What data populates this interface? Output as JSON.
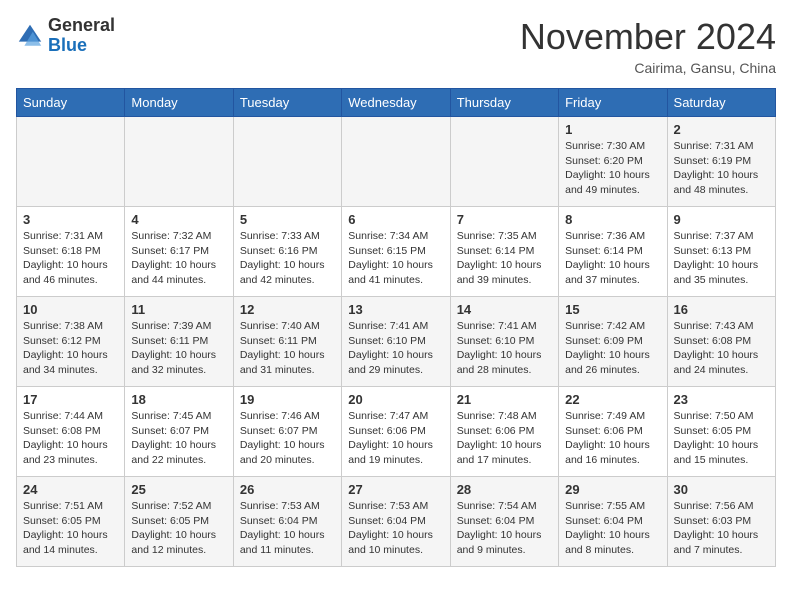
{
  "header": {
    "logo_line1": "General",
    "logo_line2": "Blue",
    "month": "November 2024",
    "location": "Cairima, Gansu, China"
  },
  "weekdays": [
    "Sunday",
    "Monday",
    "Tuesday",
    "Wednesday",
    "Thursday",
    "Friday",
    "Saturday"
  ],
  "weeks": [
    [
      {
        "day": "",
        "info": ""
      },
      {
        "day": "",
        "info": ""
      },
      {
        "day": "",
        "info": ""
      },
      {
        "day": "",
        "info": ""
      },
      {
        "day": "",
        "info": ""
      },
      {
        "day": "1",
        "info": "Sunrise: 7:30 AM\nSunset: 6:20 PM\nDaylight: 10 hours\nand 49 minutes."
      },
      {
        "day": "2",
        "info": "Sunrise: 7:31 AM\nSunset: 6:19 PM\nDaylight: 10 hours\nand 48 minutes."
      }
    ],
    [
      {
        "day": "3",
        "info": "Sunrise: 7:31 AM\nSunset: 6:18 PM\nDaylight: 10 hours\nand 46 minutes."
      },
      {
        "day": "4",
        "info": "Sunrise: 7:32 AM\nSunset: 6:17 PM\nDaylight: 10 hours\nand 44 minutes."
      },
      {
        "day": "5",
        "info": "Sunrise: 7:33 AM\nSunset: 6:16 PM\nDaylight: 10 hours\nand 42 minutes."
      },
      {
        "day": "6",
        "info": "Sunrise: 7:34 AM\nSunset: 6:15 PM\nDaylight: 10 hours\nand 41 minutes."
      },
      {
        "day": "7",
        "info": "Sunrise: 7:35 AM\nSunset: 6:14 PM\nDaylight: 10 hours\nand 39 minutes."
      },
      {
        "day": "8",
        "info": "Sunrise: 7:36 AM\nSunset: 6:14 PM\nDaylight: 10 hours\nand 37 minutes."
      },
      {
        "day": "9",
        "info": "Sunrise: 7:37 AM\nSunset: 6:13 PM\nDaylight: 10 hours\nand 35 minutes."
      }
    ],
    [
      {
        "day": "10",
        "info": "Sunrise: 7:38 AM\nSunset: 6:12 PM\nDaylight: 10 hours\nand 34 minutes."
      },
      {
        "day": "11",
        "info": "Sunrise: 7:39 AM\nSunset: 6:11 PM\nDaylight: 10 hours\nand 32 minutes."
      },
      {
        "day": "12",
        "info": "Sunrise: 7:40 AM\nSunset: 6:11 PM\nDaylight: 10 hours\nand 31 minutes."
      },
      {
        "day": "13",
        "info": "Sunrise: 7:41 AM\nSunset: 6:10 PM\nDaylight: 10 hours\nand 29 minutes."
      },
      {
        "day": "14",
        "info": "Sunrise: 7:41 AM\nSunset: 6:10 PM\nDaylight: 10 hours\nand 28 minutes."
      },
      {
        "day": "15",
        "info": "Sunrise: 7:42 AM\nSunset: 6:09 PM\nDaylight: 10 hours\nand 26 minutes."
      },
      {
        "day": "16",
        "info": "Sunrise: 7:43 AM\nSunset: 6:08 PM\nDaylight: 10 hours\nand 24 minutes."
      }
    ],
    [
      {
        "day": "17",
        "info": "Sunrise: 7:44 AM\nSunset: 6:08 PM\nDaylight: 10 hours\nand 23 minutes."
      },
      {
        "day": "18",
        "info": "Sunrise: 7:45 AM\nSunset: 6:07 PM\nDaylight: 10 hours\nand 22 minutes."
      },
      {
        "day": "19",
        "info": "Sunrise: 7:46 AM\nSunset: 6:07 PM\nDaylight: 10 hours\nand 20 minutes."
      },
      {
        "day": "20",
        "info": "Sunrise: 7:47 AM\nSunset: 6:06 PM\nDaylight: 10 hours\nand 19 minutes."
      },
      {
        "day": "21",
        "info": "Sunrise: 7:48 AM\nSunset: 6:06 PM\nDaylight: 10 hours\nand 17 minutes."
      },
      {
        "day": "22",
        "info": "Sunrise: 7:49 AM\nSunset: 6:06 PM\nDaylight: 10 hours\nand 16 minutes."
      },
      {
        "day": "23",
        "info": "Sunrise: 7:50 AM\nSunset: 6:05 PM\nDaylight: 10 hours\nand 15 minutes."
      }
    ],
    [
      {
        "day": "24",
        "info": "Sunrise: 7:51 AM\nSunset: 6:05 PM\nDaylight: 10 hours\nand 14 minutes."
      },
      {
        "day": "25",
        "info": "Sunrise: 7:52 AM\nSunset: 6:05 PM\nDaylight: 10 hours\nand 12 minutes."
      },
      {
        "day": "26",
        "info": "Sunrise: 7:53 AM\nSunset: 6:04 PM\nDaylight: 10 hours\nand 11 minutes."
      },
      {
        "day": "27",
        "info": "Sunrise: 7:53 AM\nSunset: 6:04 PM\nDaylight: 10 hours\nand 10 minutes."
      },
      {
        "day": "28",
        "info": "Sunrise: 7:54 AM\nSunset: 6:04 PM\nDaylight: 10 hours\nand 9 minutes."
      },
      {
        "day": "29",
        "info": "Sunrise: 7:55 AM\nSunset: 6:04 PM\nDaylight: 10 hours\nand 8 minutes."
      },
      {
        "day": "30",
        "info": "Sunrise: 7:56 AM\nSunset: 6:03 PM\nDaylight: 10 hours\nand 7 minutes."
      }
    ]
  ]
}
